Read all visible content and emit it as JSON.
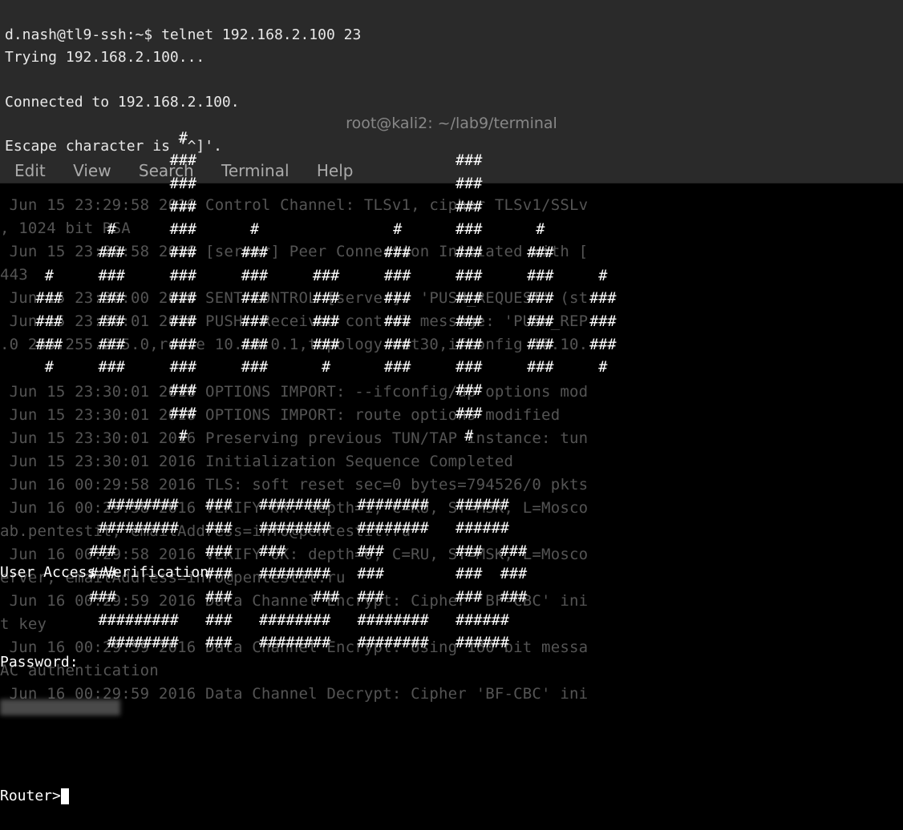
{
  "top": {
    "line1_prompt": "d.nash@tl9-ssh:~$ ",
    "line1_cmd": "telnet 192.168.2.100 23",
    "line2": "Trying 192.168.2.100...",
    "line3": "Connected to 192.168.2.100.",
    "line4": "Escape character is '^]'."
  },
  "window": {
    "title": "root@kali2: ~/lab9/terminal"
  },
  "menu": {
    "edit": "Edit",
    "view": "View",
    "search": "Search",
    "terminal": "Terminal",
    "help": "Help"
  },
  "ascii_art": " \n                    #                             \n                   ###                             ###\n                   ###                             ###\n                   ###                             ###\n            #      ###      #               #      ###      #\n           ###     ###     ###             ###     ###     ###\n     #     ###     ###     ###     ###     ###     ###     ###     #\n    ###    ###     ###     ###     ###     ###     ###     ###    ###\n    ###    ###     ###     ###     ###     ###     ###     ###    ###\n    ###    ###     ###     ###     ###     ###     ###     ###    ###\n     #     ###     ###     ###      #      ###     ###     ###     #\n                   ###                             ###\n                   ###                             ###\n                    #                               #\n\n\n            ########   ###   ########   ########   ######\n           #########   ###   ########   ########   ######\n          ###          ###   ###        ###        ###  ###\n          ###          ###   ########   ###        ###  ###\n          ###          ###         ###  ###        ###  ###\n           #########   ###   ########   ########   ######\n            ########   ###   ########   ########   ######",
  "session": {
    "uav": "User Access Verification",
    "password_label": "Password:",
    "router_prompt": "Router>"
  },
  "background_log": " Jun 15 23:29:58 2016 Control Channel: TLSv1, cipher TLSv1/SSLv\n, 1024 bit RSA\n Jun 15 23:29:58 2016 [server] Peer Connection Initiated with [\n443\n Jun 15 23:30:00 2016 SENT CONTROL [server]: 'PUSH_REQUEST' (st\n Jun 15 23:30:01 2016 PUSH: Received control message: 'PUSH_REP\n.0 255.255.255.0,route 10.10.0.1,topology net30,ifconfig 10.10.\n \n Jun 15 23:30:01 2016 OPTIONS IMPORT: --ifconfig/up options mod\n Jun 15 23:30:01 2016 OPTIONS IMPORT: route options modified\n Jun 15 23:30:01 2016 Preserving previous TUN/TAP instance: tun\n Jun 15 23:30:01 2016 Initialization Sequence Completed\n Jun 16 00:29:58 2016 TLS: soft reset sec=0 bytes=794526/0 pkts\n Jun 16 00:29:58 2016 VERIFY OK: depth=1, C=RU, ST=MSK, L=Mosco\nab.pentestit, emailAddress=info@pentestit.ru\n Jun 16 00:29:58 2016 VERIFY OK: depth=0, C=RU, ST=MSK, L=Mosco\nerver, emailAddress=info@pentestit.ru\n Jun 16 00:29:59 2016 Data Channel Encrypt: Cipher 'BF-CBC' ini\nt key\n Jun 16 00:29:59 2016 Data Channel Encrypt: Using 160 bit messa\nAC authentication\n Jun 16 00:29:59 2016 Data Channel Decrypt: Cipher 'BF-CBC' ini"
}
